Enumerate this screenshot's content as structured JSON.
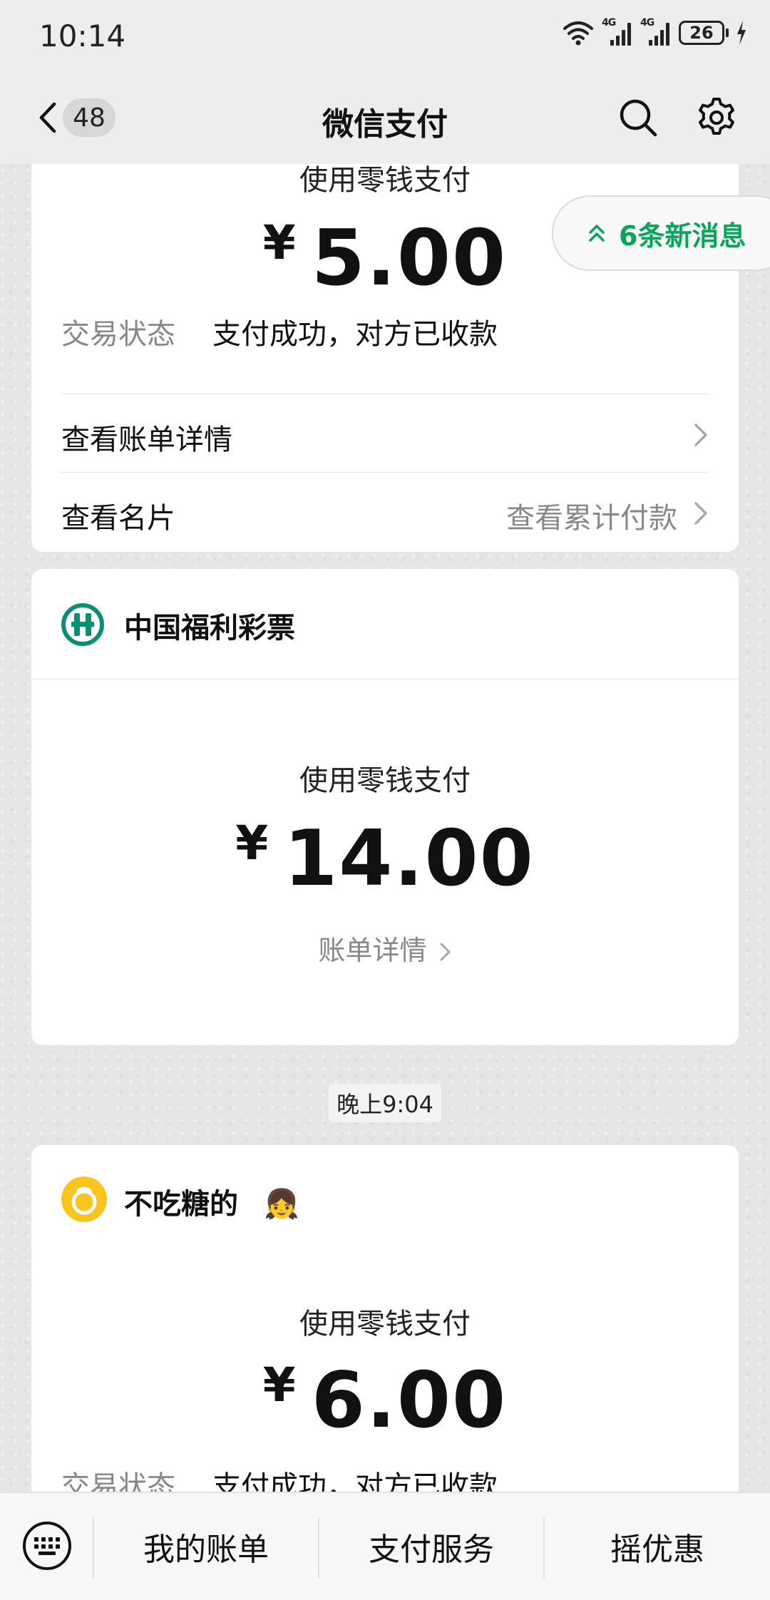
{
  "status_bar": {
    "time": "10:14",
    "network_1": "4G",
    "network_2": "4G",
    "battery": "26"
  },
  "nav": {
    "unread_count": "48",
    "title": "微信支付"
  },
  "new_messages": "6条新消息",
  "card1": {
    "method": "使用零钱支付",
    "currency": "¥",
    "amount": "5.00",
    "status_label": "交易状态",
    "status_value": "支付成功，对方已收款",
    "link1": "查看账单详情",
    "link2": "查看名片",
    "link2_right": "查看累计付款"
  },
  "card2": {
    "merchant": "中国福利彩票",
    "method": "使用零钱支付",
    "currency": "¥",
    "amount": "14.00",
    "detail": "账单详情"
  },
  "timestamp": "晚上9:04",
  "card3": {
    "merchant": "不吃糖的",
    "emoji": "👧",
    "method": "使用零钱支付",
    "currency": "¥",
    "amount": "6.00",
    "status_label": "交易状态",
    "status_value": "支付成功，对方已收款"
  },
  "bottom_menu": {
    "item1": "我的账单",
    "item2": "支付服务",
    "item3": "摇优惠"
  },
  "colors": {
    "accent_green": "#07a65a",
    "lottery_green": "#0a8f75",
    "avatar_yellow": "#f7c51e"
  }
}
